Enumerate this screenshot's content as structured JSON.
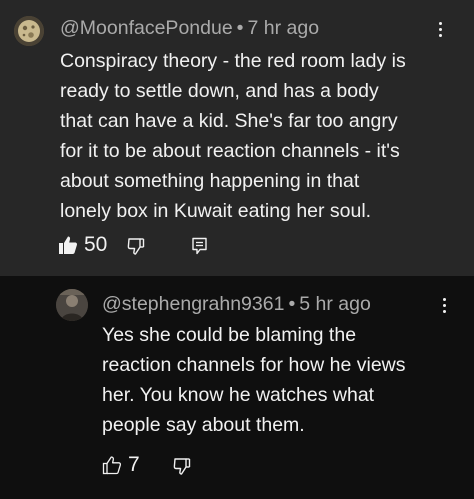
{
  "comments": [
    {
      "author": "@MoonfacePondue",
      "separator": "•",
      "time": "7 hr ago",
      "body_lines": [
        "Conspiracy theory - the red room lady is",
        "ready to settle down, and has a body",
        "that can have a kid. She's far too angry",
        "for it to be about reaction channels - it's",
        "about something happening in that",
        "lonely box in Kuwait eating her soul."
      ],
      "likes": "50",
      "liked": true,
      "icons": [
        "thumbs-up-filled-icon",
        "thumbs-down-icon",
        "reply-icon",
        "more-vert-icon"
      ]
    },
    {
      "author": "@stephengrahn9361",
      "separator": "•",
      "time": "5 hr ago",
      "body_lines": [
        "Yes she could be blaming the",
        "reaction channels for how he views",
        "her. You know he watches what",
        "people say about them."
      ],
      "likes": "7",
      "liked": false,
      "icons": [
        "thumbs-up-icon",
        "thumbs-down-icon",
        "more-vert-icon"
      ]
    }
  ],
  "colors": {
    "top_comment_bg": "#272727",
    "reply_bg": "#0f0f0f",
    "text": "#f1f1f1",
    "meta": "#aaaaaa"
  }
}
